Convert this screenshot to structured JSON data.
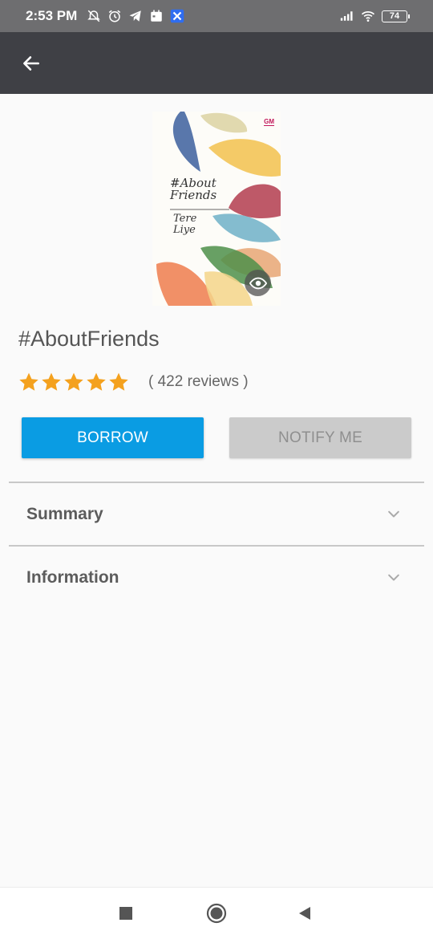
{
  "status_bar": {
    "time": "2:53 PM",
    "battery": "74",
    "icons": [
      "alarm-off-icon",
      "alarm-icon",
      "telegram-icon",
      "calendar-icon",
      "app-x-icon",
      "signal-icon",
      "wifi-icon",
      "battery-icon"
    ]
  },
  "app_bar": {
    "back_icon": "arrow-left-icon"
  },
  "book": {
    "cover": {
      "title_line1": "#About",
      "title_line2": "Friends",
      "author_line1": "Tere",
      "author_line2": "Liye",
      "publisher_logo": "GM"
    },
    "title": "#AboutFriends",
    "rating": 5,
    "rating_max": 5,
    "reviews": "( 422 reviews )"
  },
  "actions": {
    "borrow_label": "BORROW",
    "notify_label": "NOTIFY ME"
  },
  "sections": [
    {
      "label": "Summary"
    },
    {
      "label": "Information"
    }
  ],
  "colors": {
    "primary": "#0a9ce3",
    "star": "#f4a11e",
    "app_bar": "#3f4045",
    "status_bar": "#6e6e70"
  }
}
